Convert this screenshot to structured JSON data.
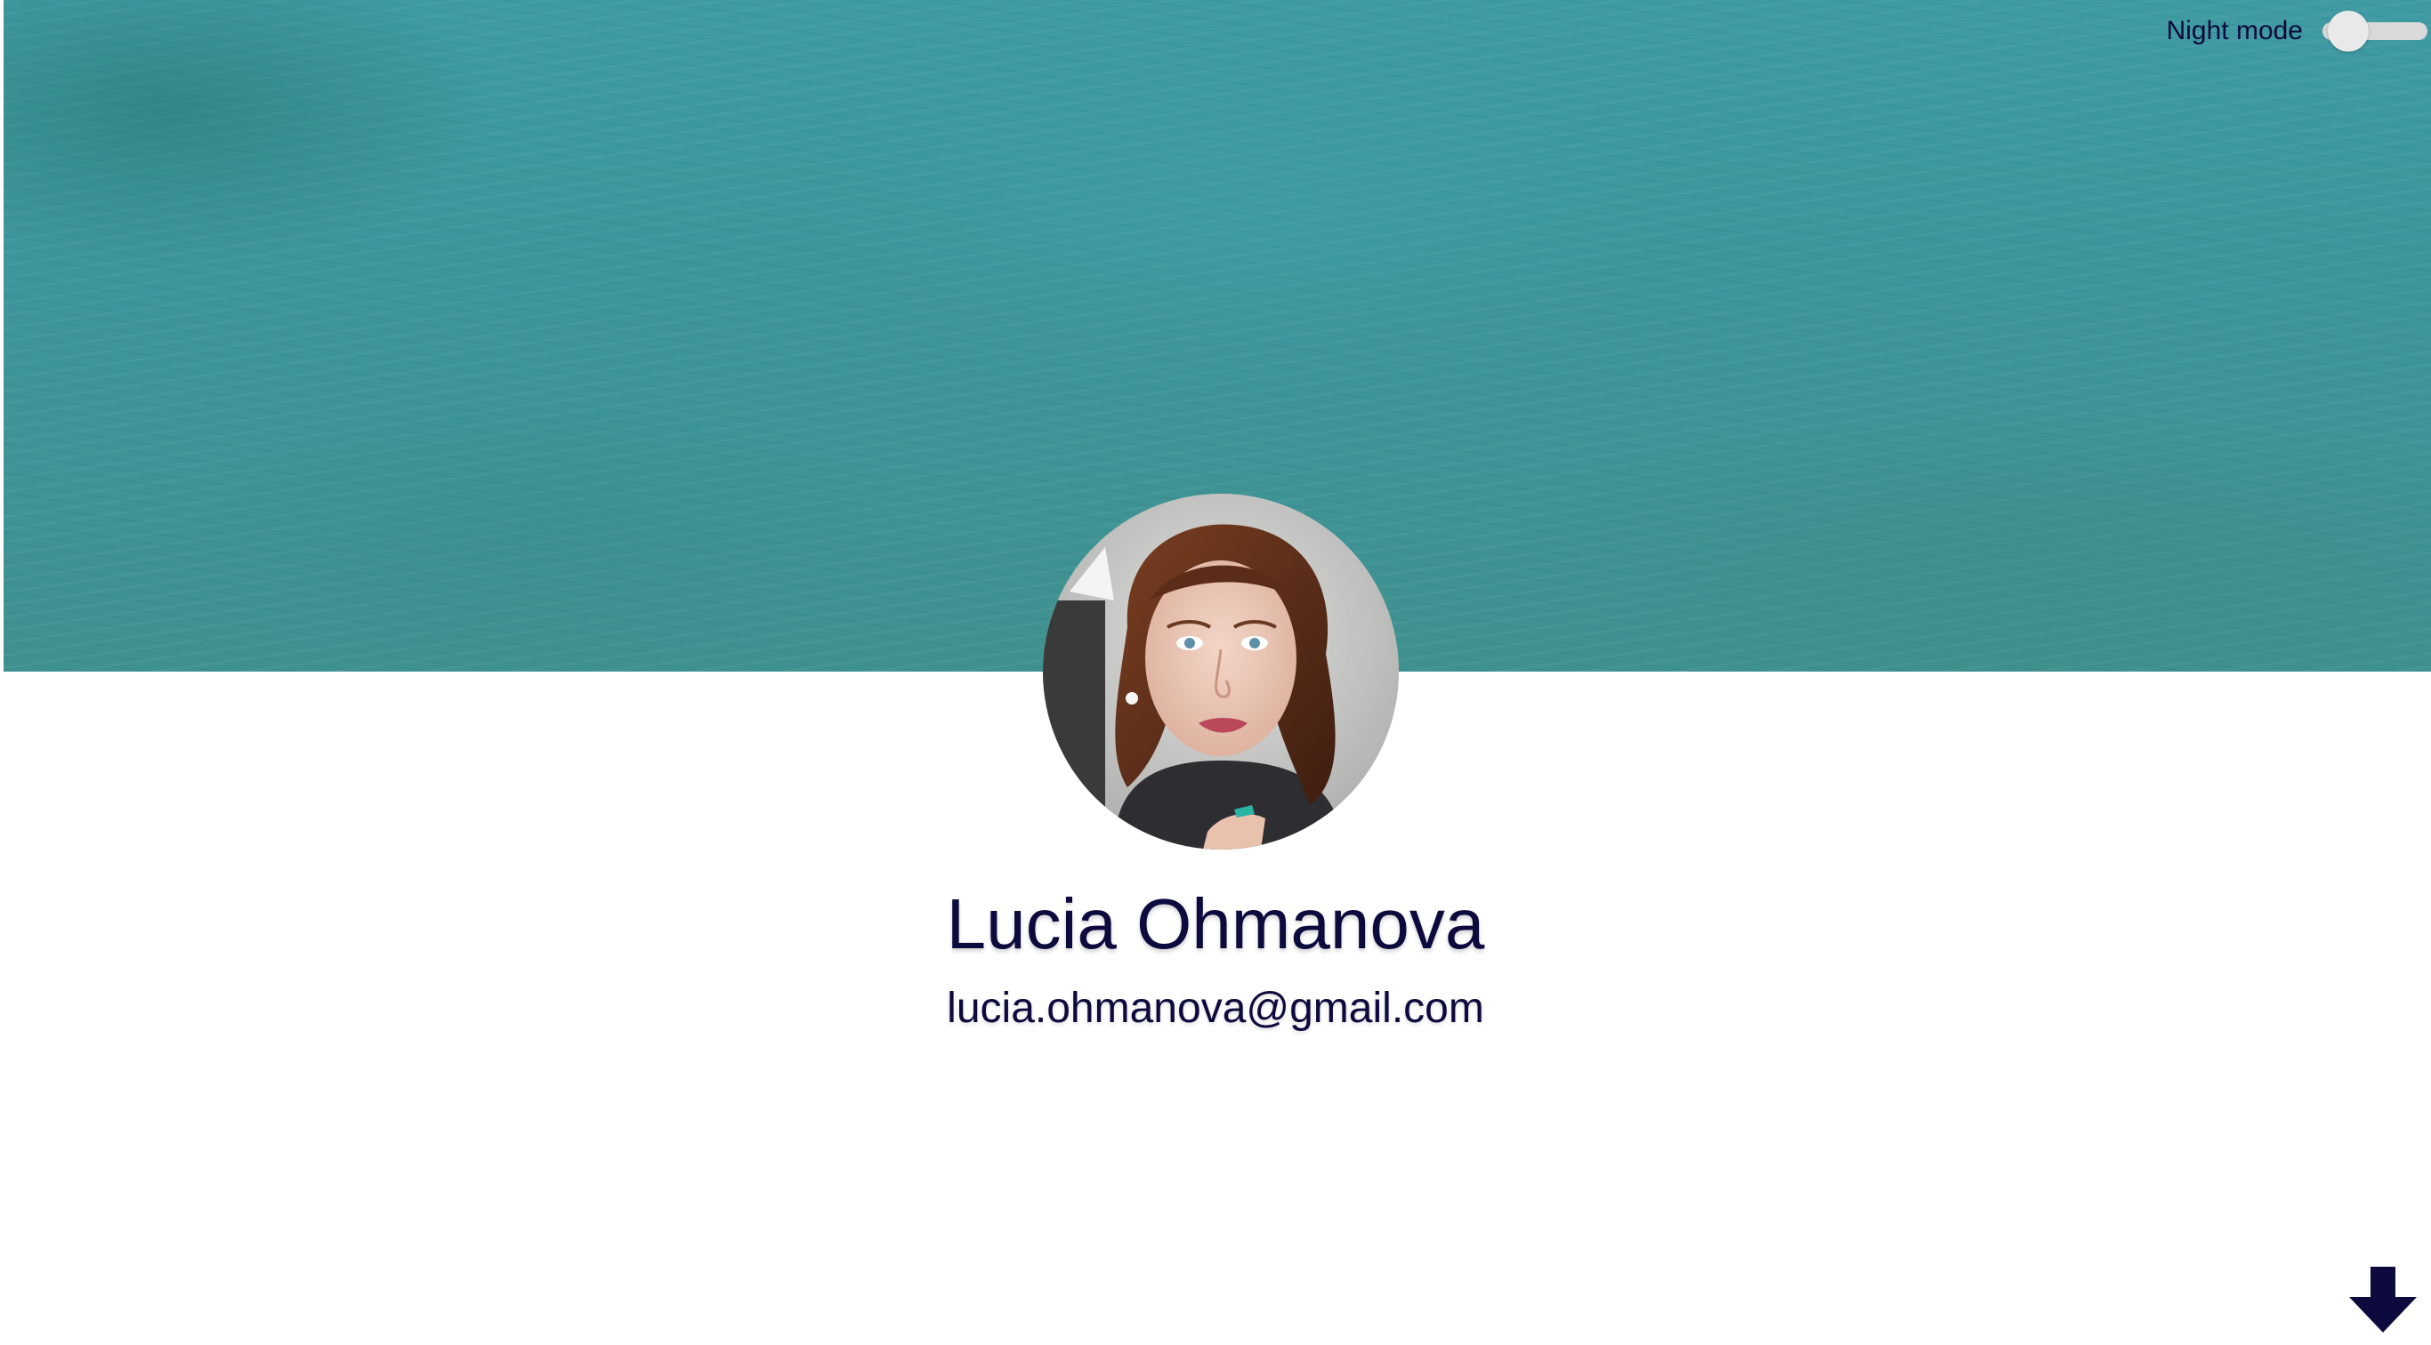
{
  "header": {
    "night_mode_label": "Night mode",
    "night_mode_enabled": false
  },
  "profile": {
    "name": "Lucia Ohmanova",
    "email": "lucia.ohmanova@gmail.com"
  },
  "icons": {
    "scroll_down": "arrow-down-icon"
  },
  "colors": {
    "text": "#0d0a3d",
    "hero_water": "#3f969c",
    "background": "#ffffff"
  }
}
